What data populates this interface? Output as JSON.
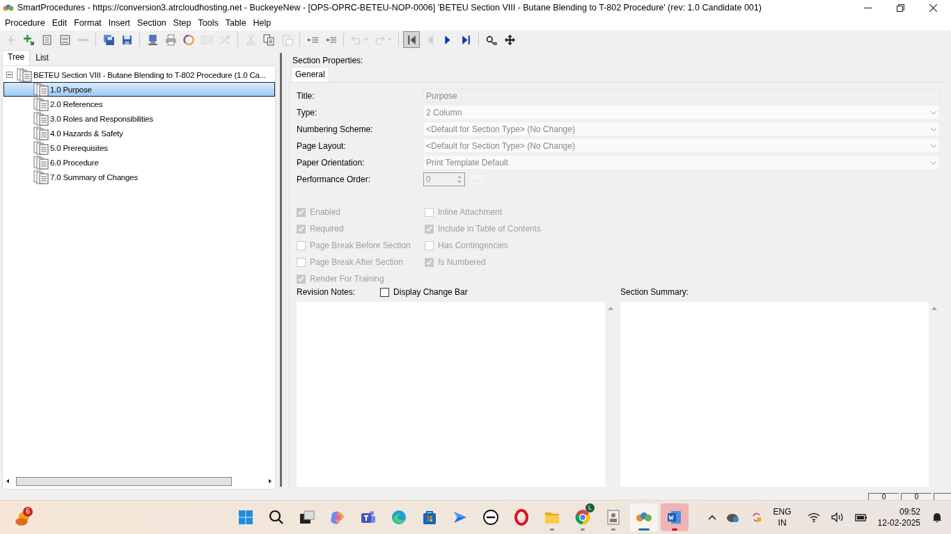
{
  "window": {
    "title": "SmartProcedures - https://conversion3.atrcloudhosting.net - BuckeyeNew - [OPS-OPRC-BETEU-NOP-0006] 'BETEU Section VIII - Butane Blending to T-802 Procedure' (rev: 1.0 Candidate 001)"
  },
  "menu": [
    "Procedure",
    "Edit",
    "Format",
    "Insert",
    "Section",
    "Step",
    "Tools",
    "Table",
    "Help"
  ],
  "toolbar": [
    {
      "kind": "plus",
      "disabled": true,
      "pressed": false
    },
    {
      "kind": "add-child",
      "disabled": false,
      "pressed": false
    },
    {
      "kind": "list",
      "disabled": false,
      "pressed": false
    },
    {
      "kind": "form",
      "disabled": false,
      "pressed": false
    },
    {
      "kind": "minus",
      "disabled": true,
      "pressed": false
    },
    {
      "kind": "separator"
    },
    {
      "kind": "save-all",
      "disabled": false,
      "pressed": false
    },
    {
      "kind": "save",
      "disabled": false,
      "pressed": false
    },
    {
      "kind": "separator"
    },
    {
      "kind": "monitor",
      "disabled": false,
      "pressed": false
    },
    {
      "kind": "printer",
      "disabled": false,
      "pressed": false
    },
    {
      "kind": "ring",
      "disabled": false,
      "pressed": false
    },
    {
      "kind": "envelope",
      "disabled": true,
      "pressed": false
    },
    {
      "kind": "shuffle",
      "disabled": true,
      "pressed": false
    },
    {
      "kind": "separator"
    },
    {
      "kind": "scissors",
      "disabled": true,
      "pressed": false
    },
    {
      "kind": "copy",
      "disabled": false,
      "pressed": false
    },
    {
      "kind": "paste",
      "disabled": true,
      "pressed": false
    },
    {
      "kind": "separator"
    },
    {
      "kind": "outdent",
      "disabled": false,
      "pressed": false
    },
    {
      "kind": "indent",
      "disabled": false,
      "pressed": false
    },
    {
      "kind": "separator"
    },
    {
      "kind": "undo",
      "disabled": true,
      "pressed": false
    },
    {
      "kind": "redo",
      "disabled": true,
      "pressed": false
    },
    {
      "kind": "separator"
    },
    {
      "kind": "first",
      "disabled": false,
      "pressed": true
    },
    {
      "kind": "prev",
      "disabled": true,
      "pressed": false
    },
    {
      "kind": "next",
      "disabled": false,
      "pressed": false
    },
    {
      "kind": "last",
      "disabled": false,
      "pressed": false
    },
    {
      "kind": "separator"
    },
    {
      "kind": "find",
      "disabled": false,
      "pressed": false
    },
    {
      "kind": "move",
      "disabled": false,
      "pressed": false
    }
  ],
  "left_tabs": [
    {
      "label": "Tree",
      "selected": true
    },
    {
      "label": "List",
      "selected": false
    }
  ],
  "tree": {
    "label": "BETEU Section VIII - Butane Blending to T-802 Procedure (1.0 Ca...",
    "expanded": true,
    "selected": false,
    "children": [
      {
        "label": "1.0 Purpose",
        "selected": true
      },
      {
        "label": "2.0 References",
        "selected": false
      },
      {
        "label": "3.0 Roles and Responsibilities",
        "selected": false
      },
      {
        "label": "4.0 Hazards & Safety",
        "selected": false
      },
      {
        "label": "5.0 Prerequisites",
        "selected": false
      },
      {
        "label": "6.0 Procedure",
        "selected": false
      },
      {
        "label": "7.0 Summary of Changes",
        "selected": false
      }
    ]
  },
  "properties": {
    "heading": "Section Properties:",
    "tabs": [
      {
        "label": "General",
        "selected": true
      }
    ],
    "fields": [
      {
        "label": "Title:",
        "kind": "text",
        "value": "Purpose",
        "disabled": true
      },
      {
        "label": "Type:",
        "kind": "select",
        "value": "2 Column",
        "disabled": true
      },
      {
        "label": "Numbering Scheme:",
        "kind": "select",
        "value": "<Default for Section Type> (No Change)",
        "disabled": true
      },
      {
        "label": "Page Layout:",
        "kind": "select",
        "value": "<Default for Section Type> (No Change)",
        "disabled": true
      },
      {
        "label": "Paper Orientation:",
        "kind": "select",
        "value": "Print Template Default",
        "disabled": true
      },
      {
        "label": "Performance Order:",
        "kind": "spinner",
        "value": "0",
        "button": "...",
        "disabled": true
      }
    ],
    "checkboxes_left": [
      {
        "label": "Enabled",
        "checked": true,
        "disabled": true
      },
      {
        "label": "Required",
        "checked": true,
        "disabled": true
      },
      {
        "label": "Page Break Before Section",
        "checked": false,
        "disabled": true
      },
      {
        "label": "Page Break After Section",
        "checked": false,
        "disabled": true
      },
      {
        "label": "Render For Training",
        "checked": true,
        "disabled": true
      }
    ],
    "checkboxes_right": [
      {
        "label": "Inline Attachment",
        "checked": false,
        "disabled": true
      },
      {
        "label": "Include in Table of Contents",
        "checked": true,
        "disabled": true
      },
      {
        "label": "Has Contingencies",
        "checked": false,
        "disabled": true
      },
      {
        "label": "Is Numbered",
        "checked": true,
        "disabled": true
      }
    ],
    "revision_notes_label": "Revision Notes:",
    "display_change_bar": {
      "label": "Display Change Bar",
      "checked": false,
      "disabled": false
    },
    "section_summary_label": "Section Summary:"
  },
  "status_bar": {
    "panes": [
      "0",
      "0"
    ]
  },
  "taskbar": {
    "weather_badge": "6",
    "apps": [
      {
        "kind": "start",
        "running": false,
        "focused": false
      },
      {
        "kind": "search",
        "running": false,
        "focused": false
      },
      {
        "kind": "taskview",
        "running": false,
        "focused": false
      },
      {
        "kind": "swirl",
        "running": false,
        "focused": false
      },
      {
        "kind": "people",
        "running": false,
        "focused": false
      },
      {
        "kind": "wave",
        "running": false,
        "focused": false
      },
      {
        "kind": "store",
        "running": false,
        "focused": false
      },
      {
        "kind": "arrow",
        "running": false,
        "focused": false
      },
      {
        "kind": "circle-logo",
        "running": false,
        "focused": false
      },
      {
        "kind": "ring",
        "running": false,
        "focused": false
      },
      {
        "kind": "folder",
        "running": true,
        "focused": false
      },
      {
        "kind": "globe",
        "running": true,
        "focused": false,
        "badge": "L"
      },
      {
        "kind": "idcard",
        "running": true,
        "focused": false
      },
      {
        "kind": "blobs",
        "running": true,
        "focused": true
      },
      {
        "kind": "word",
        "running": true,
        "focused": false
      }
    ],
    "language": "ENG",
    "region": "IN",
    "time": "09:52",
    "date": "12-02-2025"
  }
}
